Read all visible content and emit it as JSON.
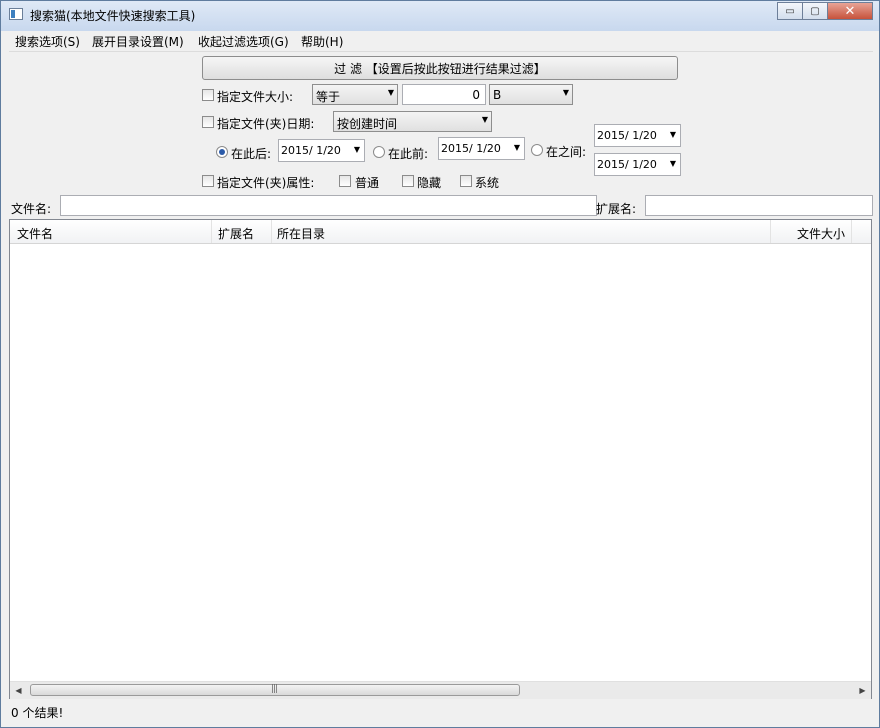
{
  "window": {
    "title": "搜索猫(本地文件快速搜索工具)"
  },
  "window_buttons": {
    "minimize": "▭",
    "maximize": "▢",
    "close": "✕"
  },
  "menu": [
    {
      "label": "搜索选项(S)"
    },
    {
      "label": "展开目录设置(M)"
    },
    {
      "label": "收起过滤选项(G)"
    },
    {
      "label": "帮助(H)"
    }
  ],
  "filter": {
    "button_label": "过 滤 【设置后按此按钮进行结果过滤】",
    "size": {
      "label": "指定文件大小:",
      "operator": "等于",
      "value": "0",
      "unit": "B",
      "checked": false
    },
    "date": {
      "label": "指定文件(夹)日期:",
      "type": "按创建时间",
      "checked": false,
      "after_label": "在此后:",
      "after_value": "2015/  1/20",
      "before_label": "在此前:",
      "before_value": "2015/  1/20",
      "between_label": "在之间:",
      "between_from": "2015/  1/20",
      "between_to": "2015/  1/20",
      "selected": "after"
    },
    "attributes": {
      "label": "指定文件(夹)属性:",
      "normal": "普通",
      "hidden": "隐藏",
      "system": "系统"
    }
  },
  "search": {
    "filename_label": "文件名:",
    "filename_value": "",
    "extension_label": "扩展名:",
    "extension_value": ""
  },
  "results": {
    "columns": [
      "文件名",
      "扩展名",
      "所在目录",
      "文件大小"
    ],
    "rows": []
  },
  "scroll_icons": {
    "left": "◀",
    "right": "▶",
    "grip": "|||"
  },
  "status": {
    "text": "0 个结果!"
  }
}
